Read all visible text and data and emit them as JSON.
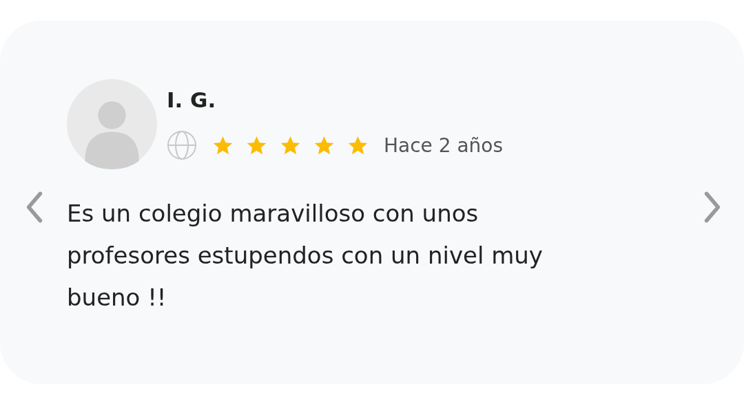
{
  "review": {
    "author": "I. G.",
    "stars": 5,
    "time": "Hace 2 años",
    "text": "Es un colegio maravilloso con unos profesores estupendos con un nivel muy bueno !!"
  }
}
